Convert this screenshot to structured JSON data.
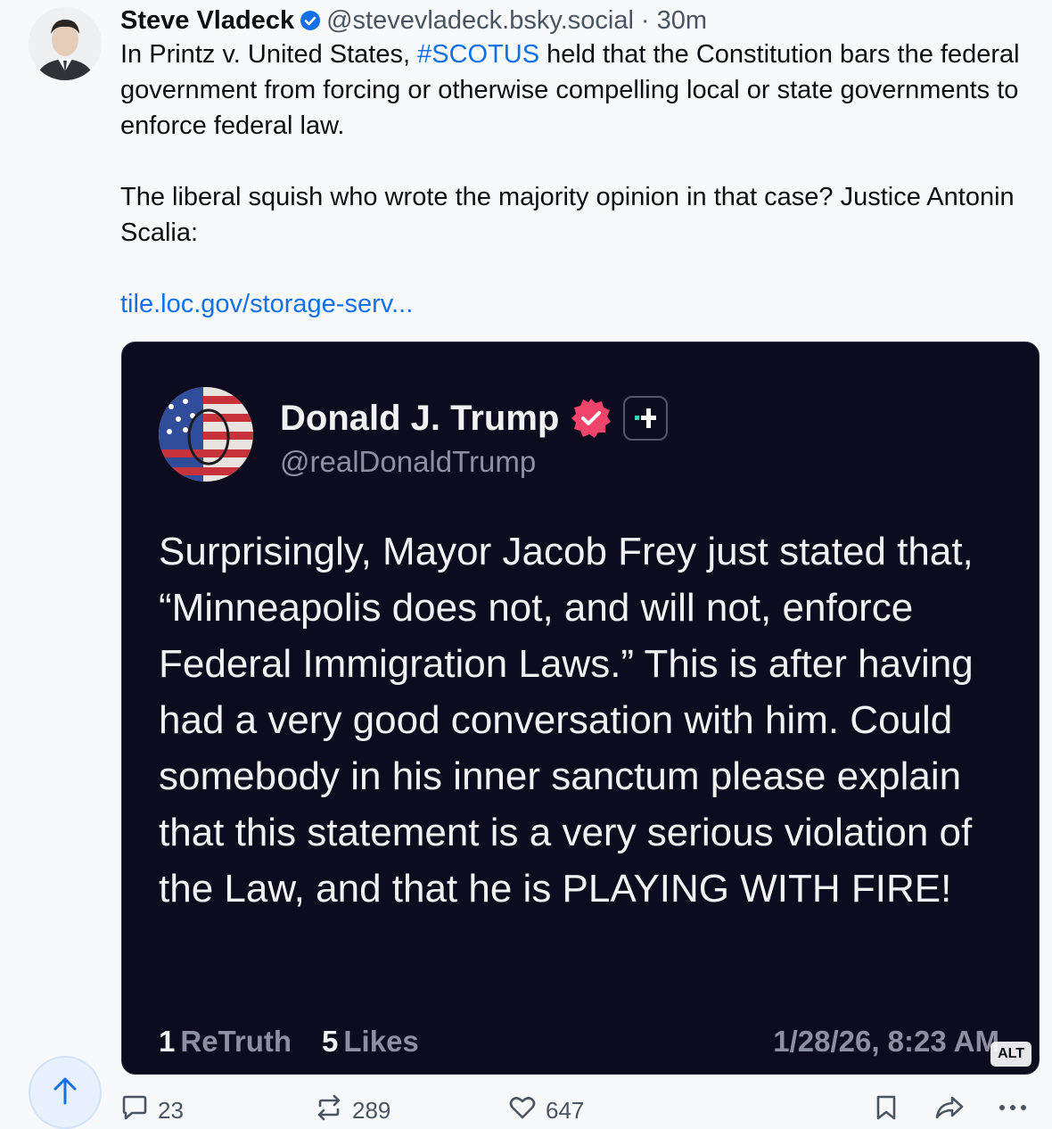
{
  "post": {
    "display_name": "Steve Vladeck",
    "handle": "@stevevladeck.bsky.social",
    "separator": "·",
    "time": "30m",
    "text_before_hashtag": "In Printz v. United States, ",
    "hashtag": "#SCOTUS",
    "text_after_hashtag": " held that the Constitution bars the federal government from forcing or otherwise compelling local or state governments to enforce federal law.",
    "paragraph2": "The liberal squish who wrote the majority opinion in that case? Justice Antonin Scalia:",
    "link": "tile.loc.gov/storage-serv..."
  },
  "embed": {
    "name": "Donald J. Trump",
    "handle": "@realDonaldTrump",
    "text": "Surprisingly, Mayor Jacob Frey just stated that, “Minneapolis does not, and will not, enforce Federal Immigration Laws.” This is after having had a very good conversation with him. Could somebody in his inner sanctum please explain that this statement is a very serious violation of the Law, and that he is PLAYING WITH FIRE!",
    "retruths_count": "1",
    "retruths_label": "ReTruth",
    "likes_count": "5",
    "likes_label": "Likes",
    "date": "1/28/26, 8:23 AM",
    "alt_label": "ALT"
  },
  "actions": {
    "replies": "23",
    "reposts": "289",
    "likes": "647"
  },
  "colors": {
    "accent": "#1270e8",
    "embed_background": "#0d0c1e",
    "truth_badge": "#f0446a"
  },
  "icons": [
    "verified-icon",
    "truth-verified-icon",
    "truth-plus-icon",
    "reply-icon",
    "repost-icon",
    "like-icon",
    "bookmark-icon",
    "share-icon",
    "more-icon",
    "arrow-up-icon"
  ]
}
